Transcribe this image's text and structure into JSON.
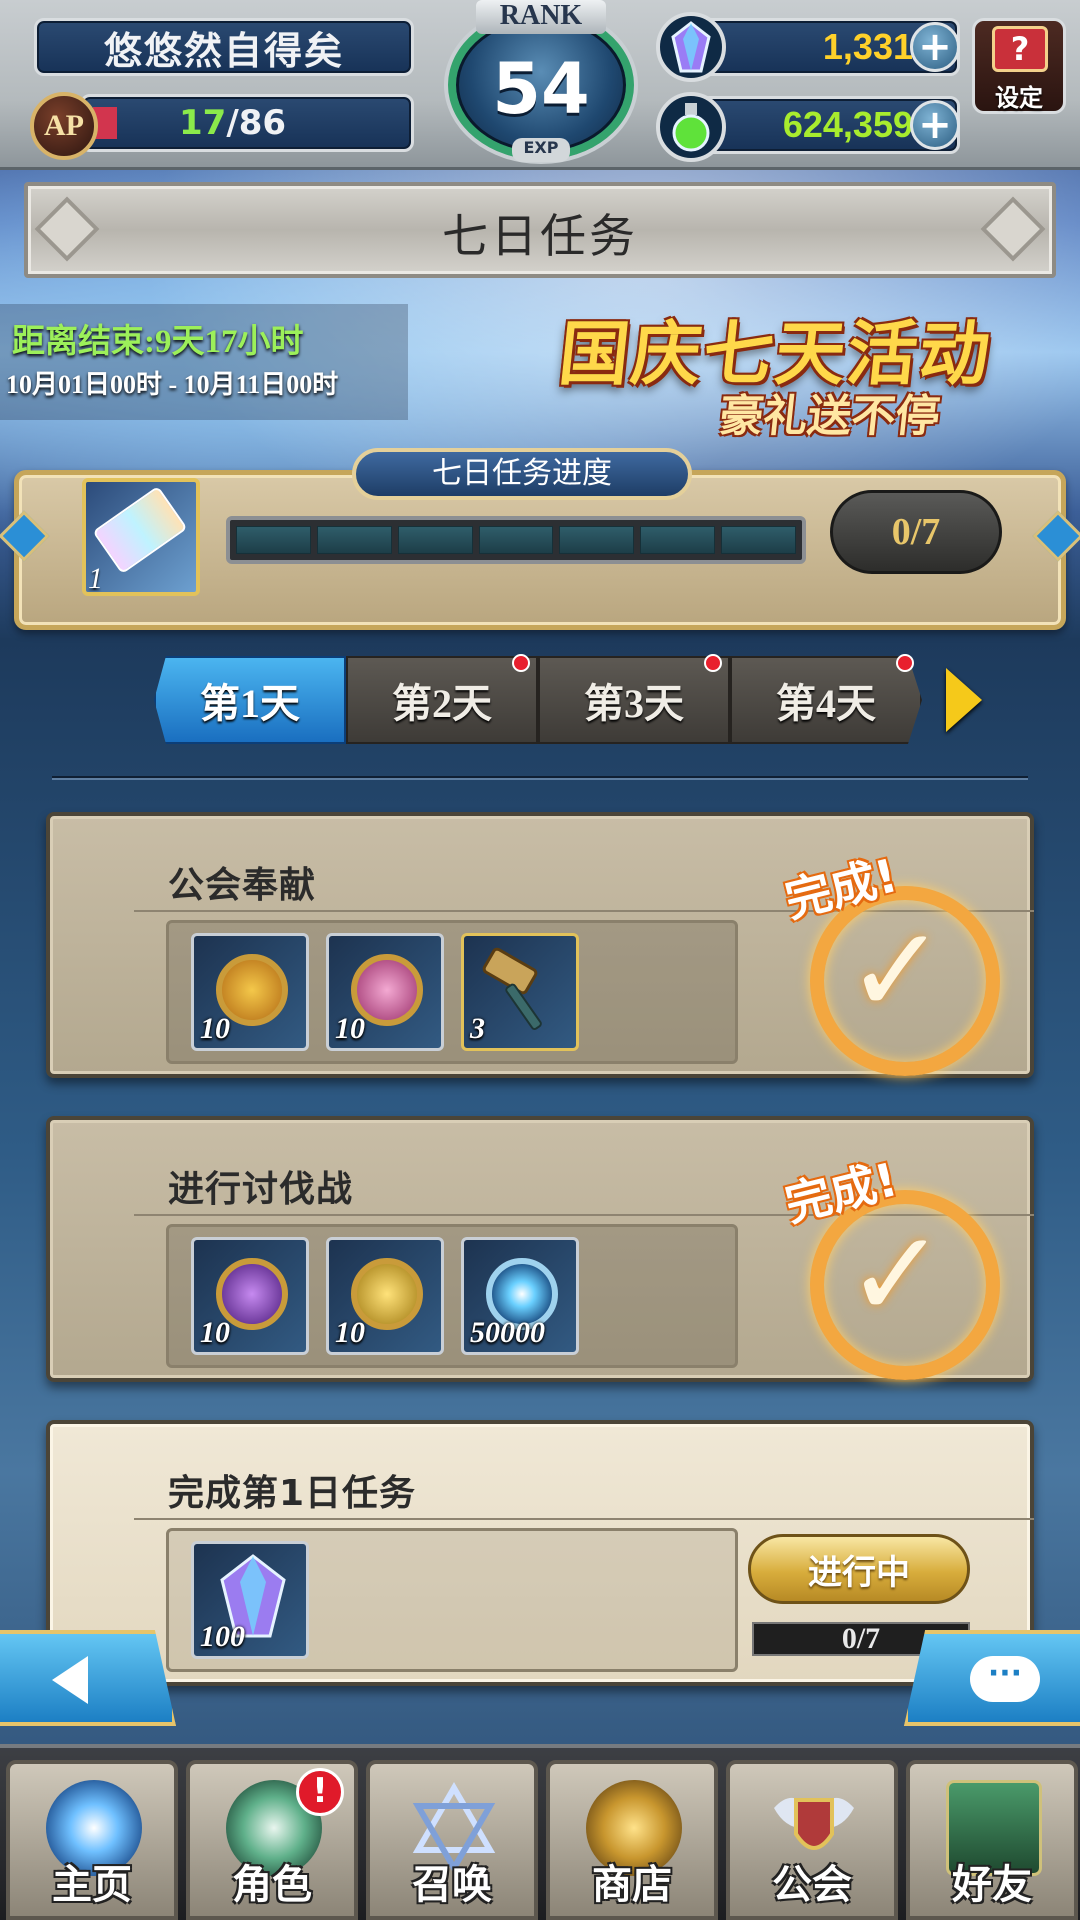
{
  "header": {
    "player_name": "悠悠然自得矣",
    "ap": {
      "icon_label": "AP",
      "current": "17",
      "separator": "/",
      "max": "86"
    },
    "rank": {
      "label": "RANK",
      "value": "54",
      "exp_label": "EXP"
    },
    "gems": {
      "value": "1,331",
      "icon": "crystal-icon",
      "plus": "+"
    },
    "gold": {
      "value": "624,359",
      "icon": "potion-icon",
      "plus": "+"
    },
    "settings": {
      "label": "设定",
      "icon_glyph": "?"
    }
  },
  "page": {
    "title": "七日任务"
  },
  "event_banner": {
    "countdown": "距离结束:9天17小时",
    "date_range": "10月01日00时 - 10月11日00时",
    "title": "国庆七天活动",
    "subtitle": "豪礼送不停"
  },
  "progress": {
    "header": "七日任务进度",
    "ticket_count": "1",
    "count": "0/7",
    "completed": 0,
    "total": 7
  },
  "day_tabs": [
    {
      "label": "第1天",
      "selected": true,
      "has_dot": false
    },
    {
      "label": "第2天",
      "selected": false,
      "has_dot": true
    },
    {
      "label": "第3天",
      "selected": false,
      "has_dot": true
    },
    {
      "label": "第4天",
      "selected": false,
      "has_dot": true
    }
  ],
  "tasks": [
    {
      "title": "公会奉献",
      "status": "完成!",
      "rewards": [
        {
          "icon": "sun-medal-icon",
          "qty": "10",
          "color": "#e9a82a"
        },
        {
          "icon": "lotus-medal-icon",
          "qty": "10",
          "color": "#d86aa6"
        },
        {
          "icon": "hammer-icon",
          "qty": "3",
          "color": "#c9a45a"
        }
      ]
    },
    {
      "title": "进行讨伐战",
      "status": "完成!",
      "rewards": [
        {
          "icon": "moon-medal-icon",
          "qty": "10",
          "color": "#8a3fb8"
        },
        {
          "icon": "sword-medal-icon",
          "qty": "10",
          "color": "#d9b23a"
        },
        {
          "icon": "star-orb-icon",
          "qty": "50000",
          "color": "#4fb3e6"
        }
      ]
    },
    {
      "title": "完成第1日任务",
      "status_button": "进行中",
      "progress": "0/7",
      "rewards": [
        {
          "icon": "crystal-icon",
          "qty": "100",
          "color": "#9b7cf0"
        }
      ]
    }
  ],
  "floating": {
    "chat_glyph": "···"
  },
  "bottom_nav": [
    {
      "label": "主页",
      "icon": "home-portal-icon",
      "color": "#3c8fe0"
    },
    {
      "label": "角色",
      "icon": "character-icon",
      "color": "#5fb08a",
      "alert": "!"
    },
    {
      "label": "召唤",
      "icon": "hexagram-icon",
      "color": "#5f7fb0"
    },
    {
      "label": "商店",
      "icon": "coin-bag-icon",
      "color": "#b08a3a"
    },
    {
      "label": "公会",
      "icon": "winged-shield-icon",
      "color": "#b03a3a"
    },
    {
      "label": "好友",
      "icon": "handshake-icon",
      "color": "#3a8a5a"
    }
  ]
}
